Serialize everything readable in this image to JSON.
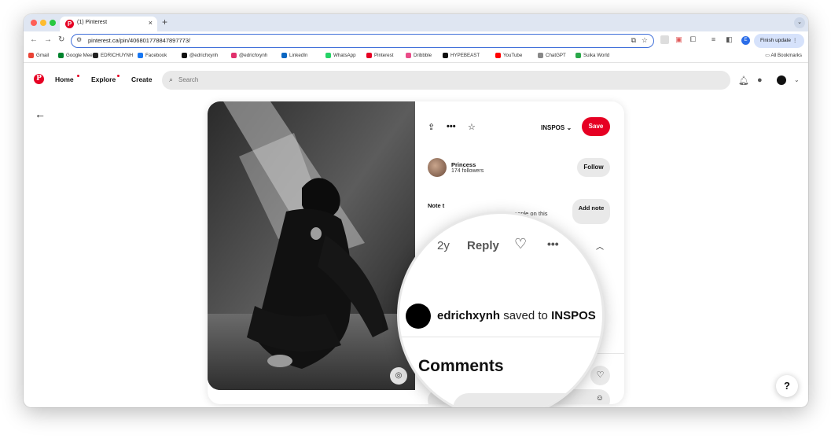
{
  "browser": {
    "tab_title": "(1) Pinterest",
    "tab_close": "×",
    "new_tab": "+",
    "url": "pinterest.ca/pin/406801778847897773/",
    "finish_update": "Finish update",
    "profile_initial": "E",
    "bookmarks": [
      {
        "label": "Gmail",
        "color": "#ea4335"
      },
      {
        "label": "Google Meet",
        "color": "#00832d"
      },
      {
        "label": "EDRICHUYNH",
        "color": "#222222"
      },
      {
        "label": "Facebook",
        "color": "#1877f2"
      },
      {
        "label": "@edrichxynh",
        "color": "#111111"
      },
      {
        "label": "@edrichxynh",
        "color": "#e1306c"
      },
      {
        "label": "LinkedIn",
        "color": "#0a66c2"
      },
      {
        "label": "WhatsApp",
        "color": "#25d366"
      },
      {
        "label": "Pinterest",
        "color": "#e60023"
      },
      {
        "label": "Dribbble",
        "color": "#ea4c89"
      },
      {
        "label": "HYPEBEAST",
        "color": "#111111"
      },
      {
        "label": "YouTube",
        "color": "#ff0000"
      },
      {
        "label": "ChatGPT",
        "color": "#888888"
      },
      {
        "label": "Suika World",
        "color": "#2aa84a"
      }
    ],
    "all_bookmarks": "All Bookmarks"
  },
  "pinterest": {
    "logo": "P",
    "nav": {
      "home": "Home",
      "explore": "Explore",
      "create": "Create"
    },
    "search_placeholder": "Search",
    "brand_color": "#e60023"
  },
  "pin": {
    "board": "INSPOS",
    "save": "Save",
    "creator_name": "Princess",
    "creator_followers": "174 followers",
    "follow": "Follow",
    "note_label": "Note t",
    "people_text": "eople on this",
    "add_note": "Add note"
  },
  "magnifier": {
    "time_ago": "2y",
    "reply": "Reply",
    "more": "•••",
    "saved_user": "edrichxynh",
    "saved_to": " saved to ",
    "saved_board": "INSPOS",
    "comments_heading": "Comments"
  },
  "help": "?"
}
